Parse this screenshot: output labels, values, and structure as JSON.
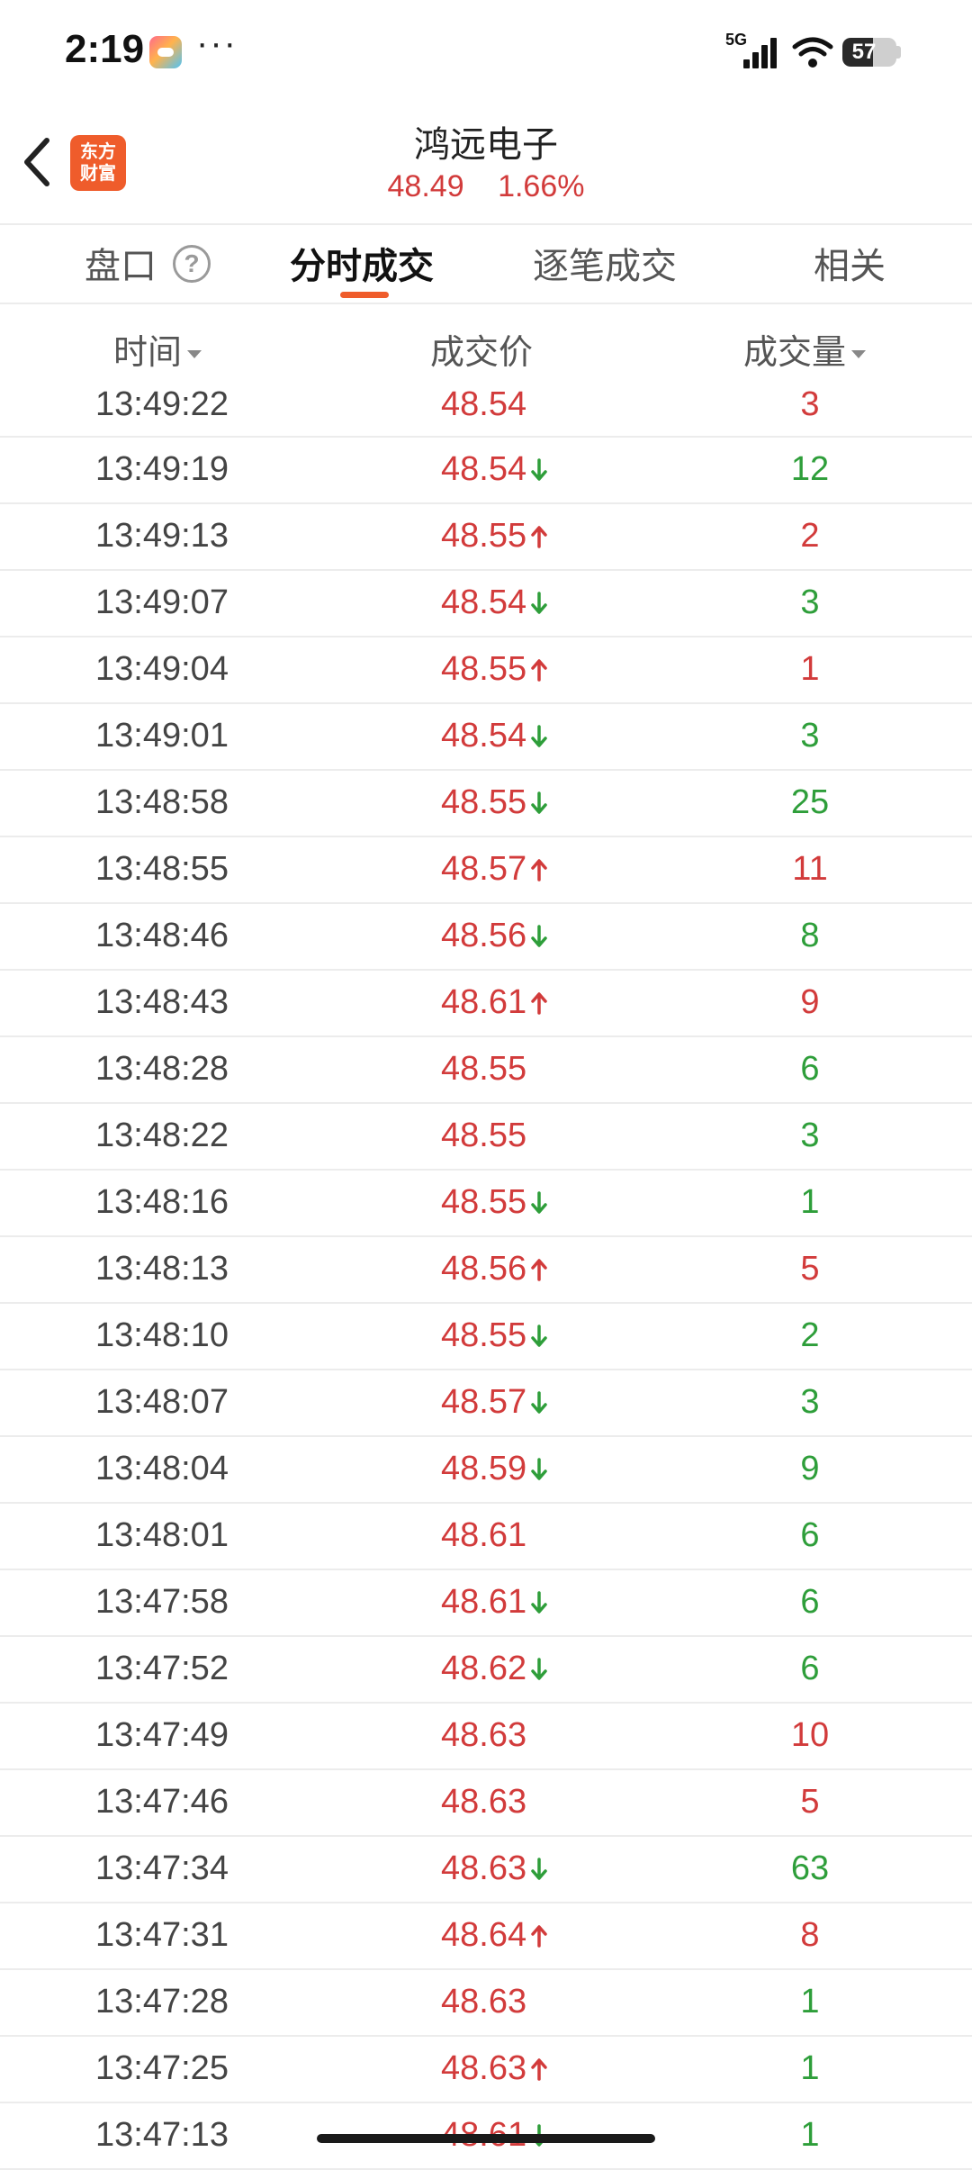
{
  "status_bar": {
    "time": "2:19",
    "more": "···",
    "network": "5G",
    "battery": "57",
    "battery_level": 0.57
  },
  "header": {
    "logo_text": "东方\n财富",
    "stock_name": "鸿远电子",
    "price": "48.49",
    "change_pct": "1.66%"
  },
  "tabs": [
    {
      "label": "盘口"
    },
    {
      "label": "分时成交"
    },
    {
      "label": "逐笔成交"
    },
    {
      "label": "相关"
    }
  ],
  "active_tab": "分时成交",
  "help_symbol": "?",
  "columns": {
    "time": "时间",
    "price": "成交价",
    "volume": "成交量"
  },
  "colors": {
    "up": "#d23b3b",
    "down": "#2e9e3a",
    "brand": "#ef5c2b"
  },
  "trades": [
    {
      "time": "13:49:22",
      "price": "48.54",
      "dir": "",
      "volume": "3",
      "side": "up"
    },
    {
      "time": "13:49:19",
      "price": "48.54",
      "dir": "down",
      "volume": "12",
      "side": "down"
    },
    {
      "time": "13:49:13",
      "price": "48.55",
      "dir": "up",
      "volume": "2",
      "side": "up"
    },
    {
      "time": "13:49:07",
      "price": "48.54",
      "dir": "down",
      "volume": "3",
      "side": "down"
    },
    {
      "time": "13:49:04",
      "price": "48.55",
      "dir": "up",
      "volume": "1",
      "side": "up"
    },
    {
      "time": "13:49:01",
      "price": "48.54",
      "dir": "down",
      "volume": "3",
      "side": "down"
    },
    {
      "time": "13:48:58",
      "price": "48.55",
      "dir": "down",
      "volume": "25",
      "side": "down"
    },
    {
      "time": "13:48:55",
      "price": "48.57",
      "dir": "up",
      "volume": "11",
      "side": "up"
    },
    {
      "time": "13:48:46",
      "price": "48.56",
      "dir": "down",
      "volume": "8",
      "side": "down"
    },
    {
      "time": "13:48:43",
      "price": "48.61",
      "dir": "up",
      "volume": "9",
      "side": "up"
    },
    {
      "time": "13:48:28",
      "price": "48.55",
      "dir": "",
      "volume": "6",
      "side": "down"
    },
    {
      "time": "13:48:22",
      "price": "48.55",
      "dir": "",
      "volume": "3",
      "side": "down"
    },
    {
      "time": "13:48:16",
      "price": "48.55",
      "dir": "down",
      "volume": "1",
      "side": "down"
    },
    {
      "time": "13:48:13",
      "price": "48.56",
      "dir": "up",
      "volume": "5",
      "side": "up"
    },
    {
      "time": "13:48:10",
      "price": "48.55",
      "dir": "down",
      "volume": "2",
      "side": "down"
    },
    {
      "time": "13:48:07",
      "price": "48.57",
      "dir": "down",
      "volume": "3",
      "side": "down"
    },
    {
      "time": "13:48:04",
      "price": "48.59",
      "dir": "down",
      "volume": "9",
      "side": "down"
    },
    {
      "time": "13:48:01",
      "price": "48.61",
      "dir": "",
      "volume": "6",
      "side": "down"
    },
    {
      "time": "13:47:58",
      "price": "48.61",
      "dir": "down",
      "volume": "6",
      "side": "down"
    },
    {
      "time": "13:47:52",
      "price": "48.62",
      "dir": "down",
      "volume": "6",
      "side": "down"
    },
    {
      "time": "13:47:49",
      "price": "48.63",
      "dir": "",
      "volume": "10",
      "side": "up"
    },
    {
      "time": "13:47:46",
      "price": "48.63",
      "dir": "",
      "volume": "5",
      "side": "up"
    },
    {
      "time": "13:47:34",
      "price": "48.63",
      "dir": "down",
      "volume": "63",
      "side": "down"
    },
    {
      "time": "13:47:31",
      "price": "48.64",
      "dir": "up",
      "volume": "8",
      "side": "up"
    },
    {
      "time": "13:47:28",
      "price": "48.63",
      "dir": "",
      "volume": "1",
      "side": "down"
    },
    {
      "time": "13:47:25",
      "price": "48.63",
      "dir": "up",
      "volume": "1",
      "side": "down"
    },
    {
      "time": "13:47:13",
      "price": "48.61",
      "dir": "down",
      "volume": "1",
      "side": "down"
    }
  ]
}
